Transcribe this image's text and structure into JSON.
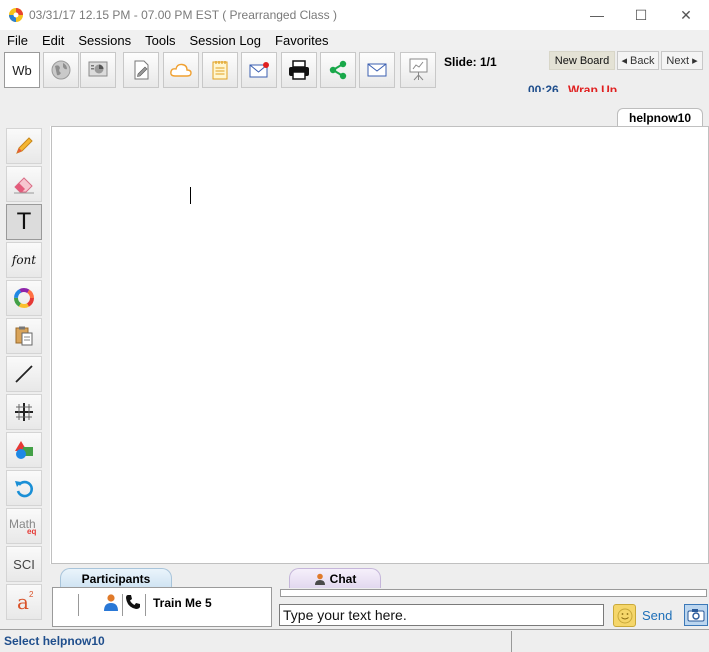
{
  "window": {
    "title": "03/31/17 12.15 PM - 07.00 PM EST ( Prearranged Class )",
    "minimize_glyph": "—",
    "maximize_glyph": "☐",
    "close_glyph": "✕"
  },
  "menu": {
    "items": [
      "File",
      "Edit",
      "Sessions",
      "Tools",
      "Session Log",
      "Favorites"
    ]
  },
  "toolbar": {
    "wb_label": "Wb",
    "buttons": [
      {
        "icon": "globe-icon"
      },
      {
        "icon": "presentation-icon"
      },
      {
        "icon": "document-edit-icon"
      },
      {
        "icon": "cloud-icon"
      },
      {
        "icon": "notepad-icon"
      },
      {
        "icon": "mail-alert-icon"
      },
      {
        "icon": "printer-icon"
      },
      {
        "icon": "share-icon"
      },
      {
        "icon": "mail-icon"
      },
      {
        "icon": "teacher-board-icon"
      }
    ],
    "slide_label": "Slide: 1/1",
    "new_board_label": "New Board",
    "back_label": "◂ Back",
    "next_label": "Next ▸",
    "timer": "00:26",
    "wrap_up_label": "Wrap Up",
    "colors": {
      "timer": "#1f4e8c",
      "wrap_up": "#e02020",
      "share": "#19a84a"
    }
  },
  "board_tab": {
    "label": "helpnow10"
  },
  "tools": [
    {
      "name": "pencil-icon"
    },
    {
      "name": "eraser-icon"
    },
    {
      "name": "text-tool-icon",
      "glyph": "T"
    },
    {
      "name": "font-icon",
      "glyph": "font"
    },
    {
      "name": "color-wheel-icon"
    },
    {
      "name": "clipboard-icon"
    },
    {
      "name": "line-tool-icon"
    },
    {
      "name": "grid-icon"
    },
    {
      "name": "shapes-icon"
    },
    {
      "name": "undo-icon"
    },
    {
      "name": "math-equation-icon",
      "glyph": "Math",
      "sub": "eq"
    },
    {
      "name": "scientific-icon",
      "glyph": "SCI"
    },
    {
      "name": "superscript-icon",
      "glyph": "a",
      "sup": "2"
    }
  ],
  "participants": {
    "tab_label": "Participants",
    "list": [
      {
        "name": "Train Me 5"
      }
    ]
  },
  "chat": {
    "tab_label": "Chat",
    "input_value": "Type your text here.",
    "send_label": "Send"
  },
  "status": {
    "text": "Select helpnow10"
  }
}
